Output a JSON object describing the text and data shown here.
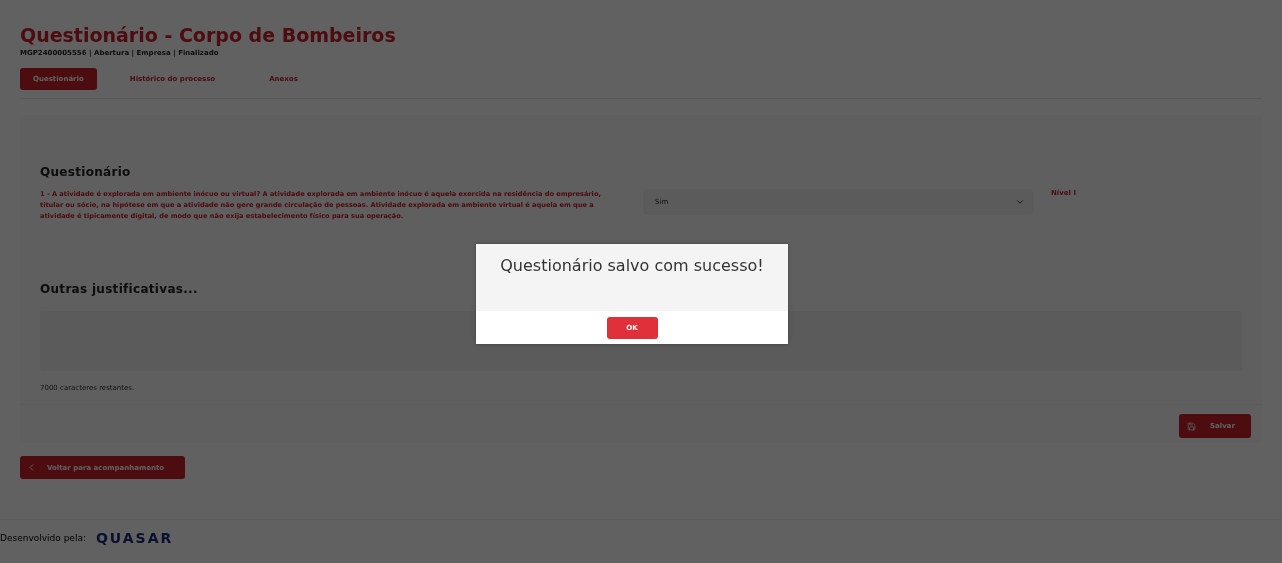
{
  "header": {
    "title": "Questionário - Corpo de Bombeiros",
    "subtitle": "MGP2400005556 | Abertura | Empresa | Finalizado"
  },
  "tabs": [
    {
      "label": "Questionário",
      "selected": true
    },
    {
      "label": "Histórico do processo",
      "selected": false
    },
    {
      "label": "Anexos",
      "selected": false
    }
  ],
  "questionnaire": {
    "heading": "Questionário",
    "questions": [
      {
        "text": "1 - A atividade é explorada em ambiente inócuo ou virtual? A atividade explorada em ambiente inócuo é aquela exercida na residência do empresário, titular ou sócio, na hipótese em que a atividade não gere grande circulação de pessoas. Atividade explorada em ambiente virtual é aquela em que a atividade é tipicamente digital, de modo que não exija estabelecimento físico para sua operação.",
        "answer": "Sim",
        "level_label": "Nível I"
      }
    ]
  },
  "justification": {
    "heading": "Outras justificativas...",
    "remaining": "7000 caracteres restantes."
  },
  "save_button": "Salvar",
  "back_button": "Voltar para acompanhamento",
  "footer": {
    "developed_by": "Desenvolvido pela:",
    "logo": "QUASAR"
  },
  "modal": {
    "message": "Questionário salvo com sucesso!",
    "ok_button": "OK"
  }
}
